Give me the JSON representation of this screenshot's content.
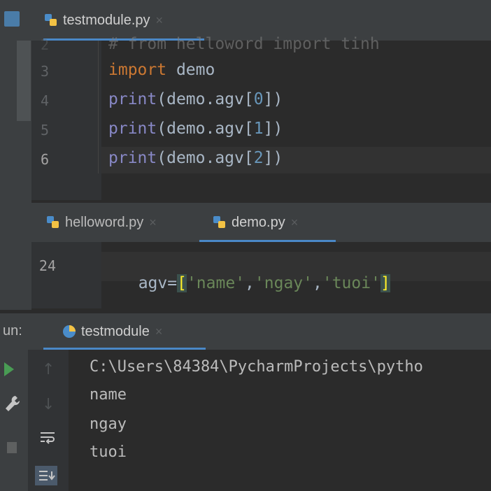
{
  "editor_top": {
    "tab_label": "testmodule.py",
    "tab_close": "×",
    "line_numbers": [
      "2",
      "3",
      "4",
      "5",
      "6"
    ],
    "lines": {
      "l2": "# from helloword import tinh",
      "l3_kw": "import",
      "l3_rest": " demo",
      "l4_fn": "print",
      "l4_a": "(demo.agv[",
      "l4_n": "0",
      "l4_b": "])",
      "l5_fn": "print",
      "l5_a": "(demo.agv[",
      "l5_n": "1",
      "l5_b": "])",
      "l6_fn": "print",
      "l6_a": "(demo.agv[",
      "l6_n": "2",
      "l6_b": "])"
    }
  },
  "editor_bottom": {
    "tabs": [
      {
        "label": "helloword.py",
        "close": "×"
      },
      {
        "label": "demo.py",
        "close": "×"
      }
    ],
    "line_number": "24",
    "code": {
      "a": "agv=",
      "ob": "[",
      "s1": "'name'",
      "c1": ",",
      "s2": "'ngay'",
      "c2": ",",
      "s3": "'tuoi'",
      "cb": "]"
    }
  },
  "run_panel": {
    "label": "un:",
    "tab_label": "testmodule",
    "tab_close": "×",
    "output_lines": [
      "C:\\Users\\84384\\PycharmProjects\\pytho",
      "name",
      "ngay",
      "tuoi"
    ]
  },
  "colors": {
    "background": "#2b2b2b",
    "tab_strip": "#3c3f41",
    "accent": "#4a88c7",
    "keyword": "#cc7832",
    "string": "#6a8759",
    "number": "#6897bb"
  },
  "icons": [
    "python-file-icon",
    "python-run-icon",
    "run-icon",
    "wrench-icon",
    "up-arrow-icon",
    "down-arrow-icon",
    "soft-wrap-icon",
    "scroll-to-end-icon"
  ]
}
